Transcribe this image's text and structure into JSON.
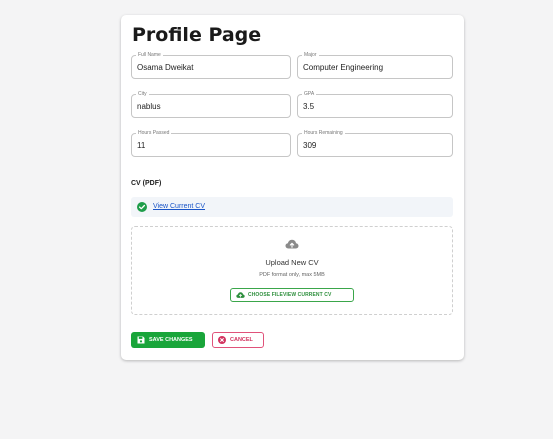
{
  "page": {
    "title": "Profile Page"
  },
  "fields": {
    "full_name": {
      "label": "Full Name",
      "value": "Osama Dweikat"
    },
    "major": {
      "label": "Major",
      "value": "Computer Engineering"
    },
    "city": {
      "label": "City",
      "value": "nablus"
    },
    "gpa": {
      "label": "GPA",
      "value": "3.5"
    },
    "hours_passed": {
      "label": "Hours Passed",
      "value": "11"
    },
    "hours_remaining": {
      "label": "Hours Remaining",
      "value": "309"
    }
  },
  "cv": {
    "section_title": "CV (PDF)",
    "view_link": "View Current CV",
    "upload_title": "Upload New CV",
    "upload_hint": "PDF format only, max 5MB",
    "choose_button": "CHOOSE FILEVIEW CURRENT CV"
  },
  "actions": {
    "save_label": "SAVE CHANGES",
    "cancel_label": "CANCEL"
  },
  "icons": {
    "check": "check-circle-icon",
    "cloud": "cloud-upload-icon",
    "save": "floppy-disk-icon",
    "cancel": "cancel-circle-icon"
  },
  "colors": {
    "primary_green": "#19a53a",
    "cancel_red": "#d2335f",
    "link_blue": "#1a55c8"
  }
}
